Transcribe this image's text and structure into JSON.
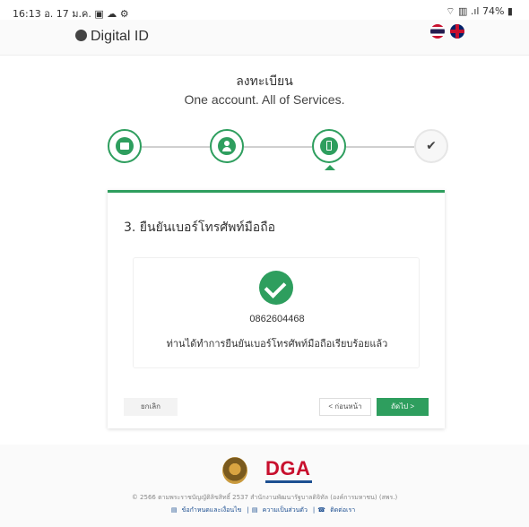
{
  "status_bar": {
    "time": "16:13",
    "date": "อ. 17 ม.ค.",
    "battery": "74%"
  },
  "header": {
    "logo_text": "Digital ID",
    "languages": [
      "th",
      "en"
    ]
  },
  "page": {
    "title_th": "ลงทะเบียน",
    "subtitle": "One account. All of Services."
  },
  "stepper": {
    "steps": [
      {
        "icon": "id-card-icon",
        "state": "complete"
      },
      {
        "icon": "user-icon",
        "state": "complete"
      },
      {
        "icon": "phone-icon",
        "state": "active"
      },
      {
        "icon": "check-icon",
        "state": "pending"
      }
    ]
  },
  "card": {
    "title": "3. ยืนยันเบอร์โทรศัพท์มือถือ",
    "phone_number": "0862604468",
    "message": "ท่านได้ทำการยืนยันเบอร์โทรศัพท์มือถือเรียบร้อยแล้ว",
    "cancel_label": "ยกเลิก",
    "back_label": "< ก่อนหน้า",
    "next_label": "ถัดไป >"
  },
  "footer": {
    "org_logo_text": "DGA",
    "copyright": "© 2566 ตามพระราชบัญญัติลิขสิทธิ์ 2537 สำนักงานพัฒนารัฐบาลดิจิทัล (องค์การมหาชน) (สพร.)",
    "links": [
      "ข้อกำหนดและเงื่อนไข",
      "ความเป็นส่วนตัว",
      "ติดต่อเรา"
    ]
  },
  "colors": {
    "accent": "#2e9e5e",
    "brand_red": "#c8102e",
    "brand_blue": "#1d4f91"
  }
}
